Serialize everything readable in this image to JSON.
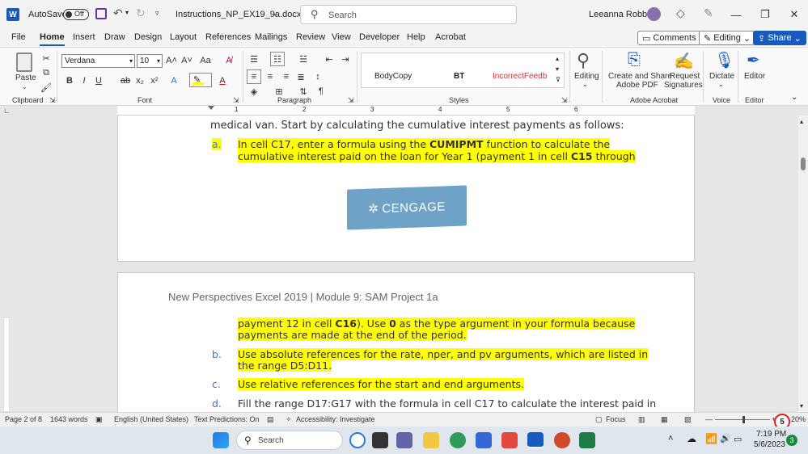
{
  "titlebar": {
    "app_icon": "W",
    "autosave_label": "AutoSave",
    "autosave_state": "Off",
    "filename": "Instructions_NP_EX19_9a.docx",
    "search_placeholder": "Search",
    "user_name": "Leeanna Robbins",
    "icons": [
      "save-icon",
      "undo-icon",
      "redo-icon",
      "customize-icon",
      "diamond-icon",
      "pen-icon",
      "minimize-icon",
      "restore-icon",
      "close-icon"
    ]
  },
  "menu": {
    "items": [
      "File",
      "Home",
      "Insert",
      "Draw",
      "Design",
      "Layout",
      "References",
      "Mailings",
      "Review",
      "View",
      "Developer",
      "Help",
      "Acrobat"
    ],
    "active": "Home",
    "comments_label": "Comments",
    "editing_label": "Editing",
    "share_label": "Share"
  },
  "ribbon": {
    "paste_label": "Paste",
    "clipboard_label": "Clipboard",
    "font_name": "Verdana",
    "font_size": "10",
    "font_label": "Font",
    "paragraph_label": "Paragraph",
    "styles": [
      "BodyCopy",
      "BT",
      "IncorrectFeedb"
    ],
    "styles_label": "Styles",
    "editing_label": "Editing",
    "acrobat_create": "Create and Share",
    "acrobat_create2": "Adobe PDF",
    "acrobat_request": "Request",
    "acrobat_request2": "Signatures",
    "acrobat_label": "Adobe Acrobat",
    "dictate_label": "Dictate",
    "voice_label": "Voice",
    "editor_label": "Editor",
    "editor_group_label": "Editor",
    "font_buttons": [
      "B",
      "I",
      "U",
      "ab",
      "x₂",
      "x²",
      "A",
      "Aa"
    ],
    "colors": {
      "highlight": "#ffff00",
      "font_color": "#ff0000",
      "accent": "#185abd"
    }
  },
  "ruler": {
    "marks": [
      "1",
      "2",
      "3",
      "4",
      "5",
      "6"
    ]
  },
  "document": {
    "page1": {
      "line_top": "medical van. Start by calculating the cumulative interest payments as follows:",
      "item_a_marker": "a.",
      "item_a_l1_pre": "In cell C17, enter a formula using the ",
      "item_a_l1_bold": "CUMIPMT",
      "item_a_l1_post": " function to calculate the",
      "item_a_l2_pre": "cumulative interest paid on the loan for Year 1 (payment 1 in cell ",
      "item_a_l2_bold": "C15",
      "item_a_l2_post": " through",
      "logo_text": "CENGAGE"
    },
    "page2": {
      "header": "New Perspectives Excel 2019 | Module 9: SAM Project 1a",
      "cont_l1_pre": "payment 12 in cell ",
      "cont_l1_bold": "C16",
      "cont_l1_mid": "). Use ",
      "cont_l1_bold2": "0",
      "cont_l1_post": " as the type argument in your formula because",
      "cont_l2": "payments are made at the end of the period.",
      "item_b_marker": "b.",
      "item_b_l1": "Use absolute references for the rate, nper, and pv arguments, which are listed in",
      "item_b_l2": "the range D5:D11.",
      "item_c_marker": "c.",
      "item_c_l1": "Use relative references for the start and end arguments.",
      "item_d_marker": "d.",
      "item_d_l1": "Fill the range D17:G17 with the formula in cell C17 to calculate the interest paid in"
    }
  },
  "status": {
    "page": "Page 2 of 8",
    "words": "1643 words",
    "language": "English (United States)",
    "predictions": "Text Predictions: On",
    "accessibility": "Accessibility: Investigate",
    "focus": "Focus",
    "zoom": "20%",
    "annotation_number": "5"
  },
  "taskbar": {
    "search_placeholder": "Search",
    "time": "7:19 PM",
    "date": "5/6/2023",
    "notifications": "3",
    "apps": [
      "windows-start-icon",
      "file-explorer-icon",
      "teams-icon",
      "folder-icon",
      "edge-icon",
      "store-icon",
      "gmail-icon",
      "word-icon",
      "powerpoint-icon",
      "excel-icon"
    ]
  }
}
